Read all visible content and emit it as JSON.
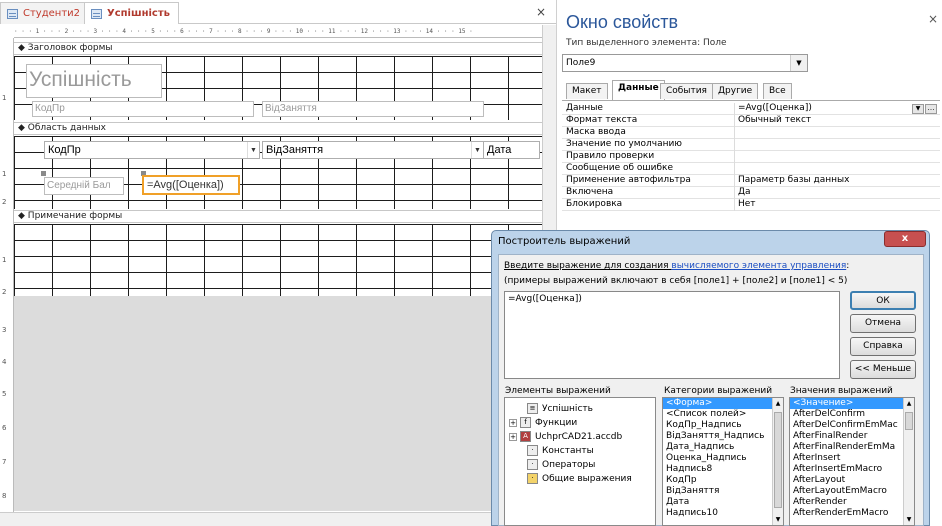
{
  "tabs": {
    "tab1": "Студенти2",
    "tab2": "Успішність",
    "close": "×"
  },
  "ruler": "· · · 1 · · · 2 · · · 3 · · · 4 · · · 5 · · · 6 · · · 7 · · · 8 · · · 9 · · · 10 · · · 11 · · · 12 · · · 13 · · · 14 · · · 15 ·",
  "vruler": [
    "1",
    "1",
    "2",
    "1",
    "2",
    "3",
    "4",
    "5",
    "6",
    "7",
    "8"
  ],
  "design": {
    "header_section": "Заголовок формы",
    "detail_section": "Область данных",
    "footer_section": "Примечание формы",
    "title": "Успішність",
    "hdr_label1": "КодПр",
    "hdr_label2": "ВідЗаняття",
    "combo1": "КодПр",
    "combo2": "ВідЗаняття",
    "combo3": "Дата",
    "avg_label": "Середній Бал",
    "avg_field": "=Avg([Оценка])"
  },
  "props": {
    "title": "Окно свойств",
    "subtitle": "Тип выделенного элемента: Поле",
    "selected": "Поле9",
    "tabs": [
      "Макет",
      "Данные",
      "События",
      "Другие",
      "Все"
    ],
    "rows": [
      {
        "k": "Данные",
        "v": "=Avg([Оценка])"
      },
      {
        "k": "Формат текста",
        "v": "Обычный текст"
      },
      {
        "k": "Маска ввода",
        "v": ""
      },
      {
        "k": "Значение по умолчанию",
        "v": ""
      },
      {
        "k": "Правило проверки",
        "v": ""
      },
      {
        "k": "Сообщение об ошибке",
        "v": ""
      },
      {
        "k": "Применение автофильтра",
        "v": "Параметр базы данных"
      },
      {
        "k": "Включена",
        "v": "Да"
      },
      {
        "k": "Блокировка",
        "v": "Нет"
      }
    ],
    "close": "×"
  },
  "dialog": {
    "title": "Построитель выражений",
    "instr_a": "Введите выражение для создания ",
    "instr_link": "вычисляемого элемента управления",
    "instr_b": ":",
    "examples": "(примеры выражений включают в себя [поле1] + [поле2] и [поле1] < 5)",
    "expression": "=Avg([Оценка])",
    "ok": "ОК",
    "cancel": "Отмена",
    "help": "Справка",
    "less": "<< Меньше",
    "col1": "Элементы выражений",
    "col2": "Категории выражений",
    "col3": "Значения выражений",
    "tree": [
      "Успішність",
      "Функции",
      "UchprCAD21.accdb",
      "Константы",
      "Операторы",
      "Общие выражения"
    ],
    "categories": [
      "<Форма>",
      "<Список полей>",
      "КодПр_Надпись",
      "ВідЗаняття_Надпись",
      "Дата_Надпись",
      "Оценка_Надпись",
      "Надпись8",
      "КодПр",
      "ВідЗаняття",
      "Дата",
      "Надпись10"
    ],
    "values": [
      "<Значение>",
      "AfterDelConfirm",
      "AfterDelConfirmEmMac",
      "AfterFinalRender",
      "AfterFinalRenderEmMa",
      "AfterInsert",
      "AfterInsertEmMacro",
      "AfterLayout",
      "AfterLayoutEmMacro",
      "AfterRender",
      "AfterRenderEmMacro"
    ],
    "close": "x"
  },
  "colors": {
    "accent": "#2b579a",
    "selection": "#3399ff",
    "dialog_frame": "#bcd3ea"
  }
}
